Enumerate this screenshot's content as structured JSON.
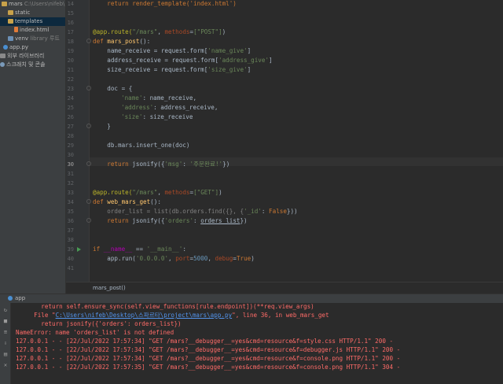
{
  "project_tree": {
    "items": [
      {
        "label": "mars",
        "suffix": "C:\\Users\\nifeb\\Desktop\\스파르타\\project\\mars",
        "icon": "folder-icon",
        "selected": false
      },
      {
        "label": "static",
        "suffix": "",
        "icon": "folder-icon",
        "selected": false
      },
      {
        "label": "templates",
        "suffix": "",
        "icon": "folder-icon",
        "selected": true
      },
      {
        "label": "index.html",
        "suffix": "",
        "icon": "html-file-icon",
        "selected": false
      },
      {
        "label": "venv",
        "suffix": "library 루트",
        "icon": "folder-icon",
        "selected": false
      },
      {
        "label": "app.py",
        "suffix": "",
        "icon": "python-file-icon",
        "selected": false
      },
      {
        "label": "외부 라이브러리",
        "suffix": "",
        "icon": "library-icon",
        "selected": false
      },
      {
        "label": "스크래치 및 콘솔",
        "suffix": "",
        "icon": "scratch-icon",
        "selected": false
      }
    ]
  },
  "editor": {
    "line_numbers": [
      "14",
      "15",
      "16",
      "17",
      "18",
      "19",
      "20",
      "21",
      "22",
      "23",
      "24",
      "25",
      "26",
      "27",
      "28",
      "29",
      "30",
      "31",
      "32",
      "33",
      "34",
      "35",
      "36",
      "37",
      "38",
      "39",
      "40",
      "41"
    ],
    "line_top_partial": "    return render_template('index.html')",
    "route_post": {
      "deco": "@app.route(",
      "path": "\"/mars\"",
      "methods_kw": "methods",
      "methods_val": "[\"POST\"]"
    },
    "def_post": {
      "kw": "def ",
      "name": "mars_post",
      "rest": "():"
    },
    "name_receive": {
      "lhs": "    name_receive = request.form[",
      "key": "'name_give'",
      "rhs": "]"
    },
    "address_receive": {
      "lhs": "    address_receive = request.form[",
      "key": "'address_give'",
      "rhs": "]"
    },
    "size_receive": {
      "lhs": "    size_receive = request.form[",
      "key": "'size_give'",
      "rhs": "]"
    },
    "doc_open": "    doc = {",
    "doc_name": {
      "key": "'name'",
      "val": ": name_receive,"
    },
    "doc_address": {
      "key": "'address'",
      "val": ": address_receive,"
    },
    "doc_size": {
      "key": "'size'",
      "val": ": size_receive"
    },
    "doc_close": "    }",
    "insert": "    db.mars.insert_one(doc)",
    "return_post": {
      "kw": "    return ",
      "call": "jsonify({",
      "key": "'msg'",
      "sep": ": ",
      "val": "'주문완료!'",
      "end": "})"
    },
    "route_get": {
      "deco": "@app.route(",
      "path": "\"/mars\"",
      "methods_kw": "methods",
      "methods_val": "[\"GET\"]"
    },
    "def_get": {
      "kw": "def ",
      "name": "web_mars_get",
      "rest": "():"
    },
    "order_list": {
      "text": "    order_list = list(db.orders.find({}, {",
      "key": "'_id'",
      "sep": ": ",
      "val": "False",
      "end": "}))"
    },
    "return_get": {
      "kw": "    return ",
      "call": "jsonify({",
      "key": "'orders'",
      "sep": ": ",
      "val": "orders_list",
      "end": "})"
    },
    "main_if": {
      "kw": "if ",
      "dunder": "__name__",
      "op": " == ",
      "str": "'__main__'",
      "end": ":"
    },
    "app_run": {
      "pre": "    app.run(",
      "host": "'0.0.0.0'",
      "sep1": ", ",
      "port_kw": "port",
      "port_val": "5000",
      "sep2": ", ",
      "debug_kw": "debug",
      "debug_val": "True",
      "end": ")"
    }
  },
  "breadcrumb": {
    "text": "mars_post()"
  },
  "run_panel": {
    "tab_label": "app",
    "lines": [
      {
        "type": "err",
        "text": "    return self.ensure_sync(self.view_functions[rule.endpoint])(**req.view_args)"
      },
      {
        "type": "file",
        "prefix": "  File \"",
        "path": "C:\\Users\\nifeb\\Desktop\\스파르타\\project\\mars\\app.py",
        "suffix": "\", line 36, in web_mars_get"
      },
      {
        "type": "err",
        "text": "    return jsonify({'orders': orders_list})"
      },
      {
        "type": "err",
        "text": "NameError: name 'orders_list' is not defined"
      },
      {
        "type": "err",
        "text": "127.0.0.1 - - [22/Jul/2022 17:57:34] \"GET /mars?__debugger__=yes&cmd=resource&f=style.css HTTP/1.1\" 200 -"
      },
      {
        "type": "err",
        "text": "127.0.0.1 - - [22/Jul/2022 17:57:34] \"GET /mars?__debugger__=yes&cmd=resource&f=debugger.js HTTP/1.1\" 200 -"
      },
      {
        "type": "err",
        "text": "127.0.0.1 - - [22/Jul/2022 17:57:34] \"GET /mars?__debugger__=yes&cmd=resource&f=console.png HTTP/1.1\" 200 -"
      },
      {
        "type": "err",
        "text": "127.0.0.1 - - [22/Jul/2022 17:57:35] \"GET /mars?__debugger__=yes&cmd=resource&f=console.png HTTP/1.1\" 304 -"
      }
    ]
  },
  "colors": {
    "keyword": "#cc7832",
    "string": "#6a8759",
    "function": "#ffc66d",
    "decorator": "#bbb529",
    "number": "#6897bb",
    "error": "#ff6b68",
    "link": "#5394ec"
  }
}
